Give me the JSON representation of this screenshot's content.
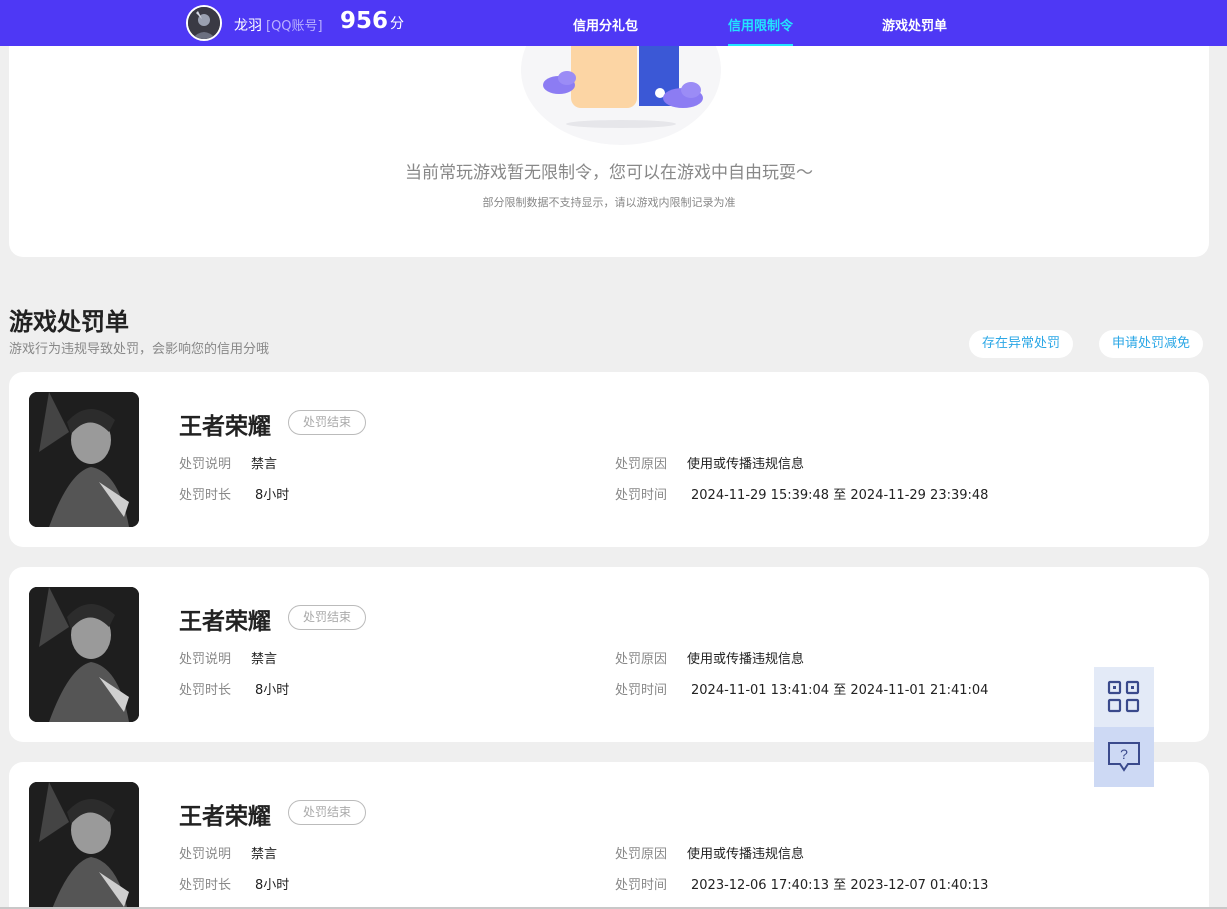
{
  "header": {
    "user_name": "龙羽",
    "account_type": "[QQ账号]",
    "score": "956",
    "score_unit": "分",
    "nav": [
      {
        "label": "信用分礼包",
        "active": false
      },
      {
        "label": "信用限制令",
        "active": true
      },
      {
        "label": "游戏处罚单",
        "active": false
      }
    ],
    "colors": {
      "bar": "#4e38f5",
      "active": "#22e4ff"
    }
  },
  "restriction": {
    "empty_title": "当前常玩游戏暂无限制令，您可以在游戏中自由玩耍～",
    "empty_sub": "部分限制数据不支持显示，请以游戏内限制记录为准"
  },
  "penalty_section": {
    "title": "游戏处罚单",
    "subtitle": "游戏行为违规导致处罚，会影响您的信用分哦",
    "buttons": [
      "存在异常处罚",
      "申请处罚减免"
    ],
    "labels": {
      "desc": "处罚说明",
      "duration": "处罚时长",
      "reason": "处罚原因",
      "time": "处罚时间",
      "to": "至"
    },
    "items": [
      {
        "game": "王者荣耀",
        "status": "处罚结束",
        "desc": "禁言",
        "duration": "8小时",
        "reason": "使用或传播违规信息",
        "start": "2024-11-29 15:39:48",
        "end": "2024-11-29 23:39:48"
      },
      {
        "game": "王者荣耀",
        "status": "处罚结束",
        "desc": "禁言",
        "duration": "8小时",
        "reason": "使用或传播违规信息",
        "start": "2024-11-01 13:41:04",
        "end": "2024-11-01 21:41:04"
      },
      {
        "game": "王者荣耀",
        "status": "处罚结束",
        "desc": "禁言",
        "duration": "8小时",
        "reason": "使用或传播违规信息",
        "start": "2023-12-06 17:40:13",
        "end": "2023-12-07 01:40:13"
      }
    ]
  },
  "floating": {
    "qr_icon": "qr-code-icon",
    "help_icon": "help-chat-icon"
  }
}
